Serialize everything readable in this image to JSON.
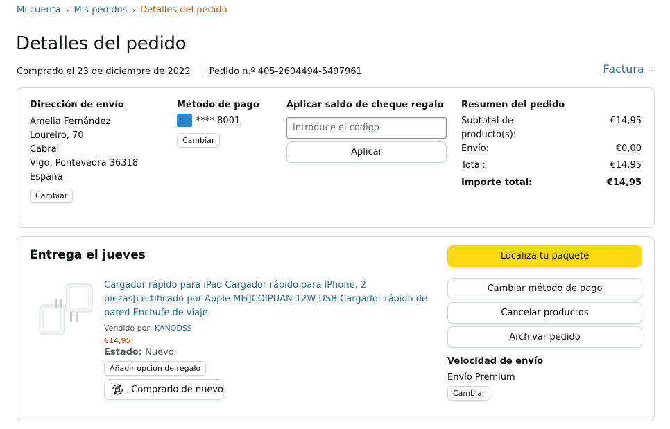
{
  "breadcrumb": {
    "my_account": "Mi cuenta",
    "my_orders": "Mis pedidos",
    "current": "Detalles del pedido",
    "separator": "›"
  },
  "page_title": "Detalles del pedido",
  "order_meta": {
    "purchased": "Comprado el 23 de diciembre de 2022",
    "order_number": "Pedido n.º 405-2604494-5497961"
  },
  "invoice": {
    "label": "Factura",
    "chevron": "⌄"
  },
  "shipping": {
    "heading": "Dirección de envío",
    "lines": [
      "Amelia Fernández",
      "Loureiro, 70",
      "Cabral",
      "Vigo, Pontevedra 36318",
      "España"
    ],
    "change_label": "Cambiar"
  },
  "payment": {
    "heading": "Método de pago",
    "card_icon": "amex-card-icon",
    "card_number": "**** 8001",
    "change_label": "Cambiar"
  },
  "gift": {
    "heading": "Aplicar saldo de cheque regalo",
    "placeholder": "Introduce el código",
    "value": "",
    "apply_label": "Aplicar"
  },
  "summary": {
    "heading": "Resumen del pedido",
    "subtotal_label": "Subtotal de producto(s):",
    "subtotal_value": "€14,95",
    "shipping_label": "Envío:",
    "shipping_value": "€0,00",
    "total_label": "Total:",
    "total_value": "€14,95",
    "grand_total_label": "Importe total:",
    "grand_total_value": "€14,95"
  },
  "delivery": {
    "heading": "Entrega el jueves",
    "product": {
      "title": "Cargador rápido para iPad Cargador rápido para iPhone, 2 piezas[certificado por Apple MFi]COIPUAN 12W USB Cargador rápido de pared Enchufe de viaje",
      "sold_by_label": "Vendido por:",
      "seller": "KANODSS",
      "price": "€14,95",
      "condition_label": "Estado:",
      "condition_value": "Nuevo",
      "gift_option_label": "Añadir opción de regalo",
      "buy_again_label": "Comprarlo de nuevo"
    },
    "actions": {
      "track": "Localiza tu paquete",
      "change_payment": "Cambiar método de pago",
      "cancel": "Cancelar productos",
      "archive": "Archivar pedido"
    },
    "shipping_speed": {
      "heading": "Velocidad de envío",
      "value": "Envío Premium",
      "change_label": "Cambiar"
    }
  },
  "colors": {
    "link": "#2a6f8c",
    "breadcrumb_current": "#c45500",
    "price": "#b12704",
    "primary_button": "#ffd814",
    "border": "#d5d9d9"
  }
}
